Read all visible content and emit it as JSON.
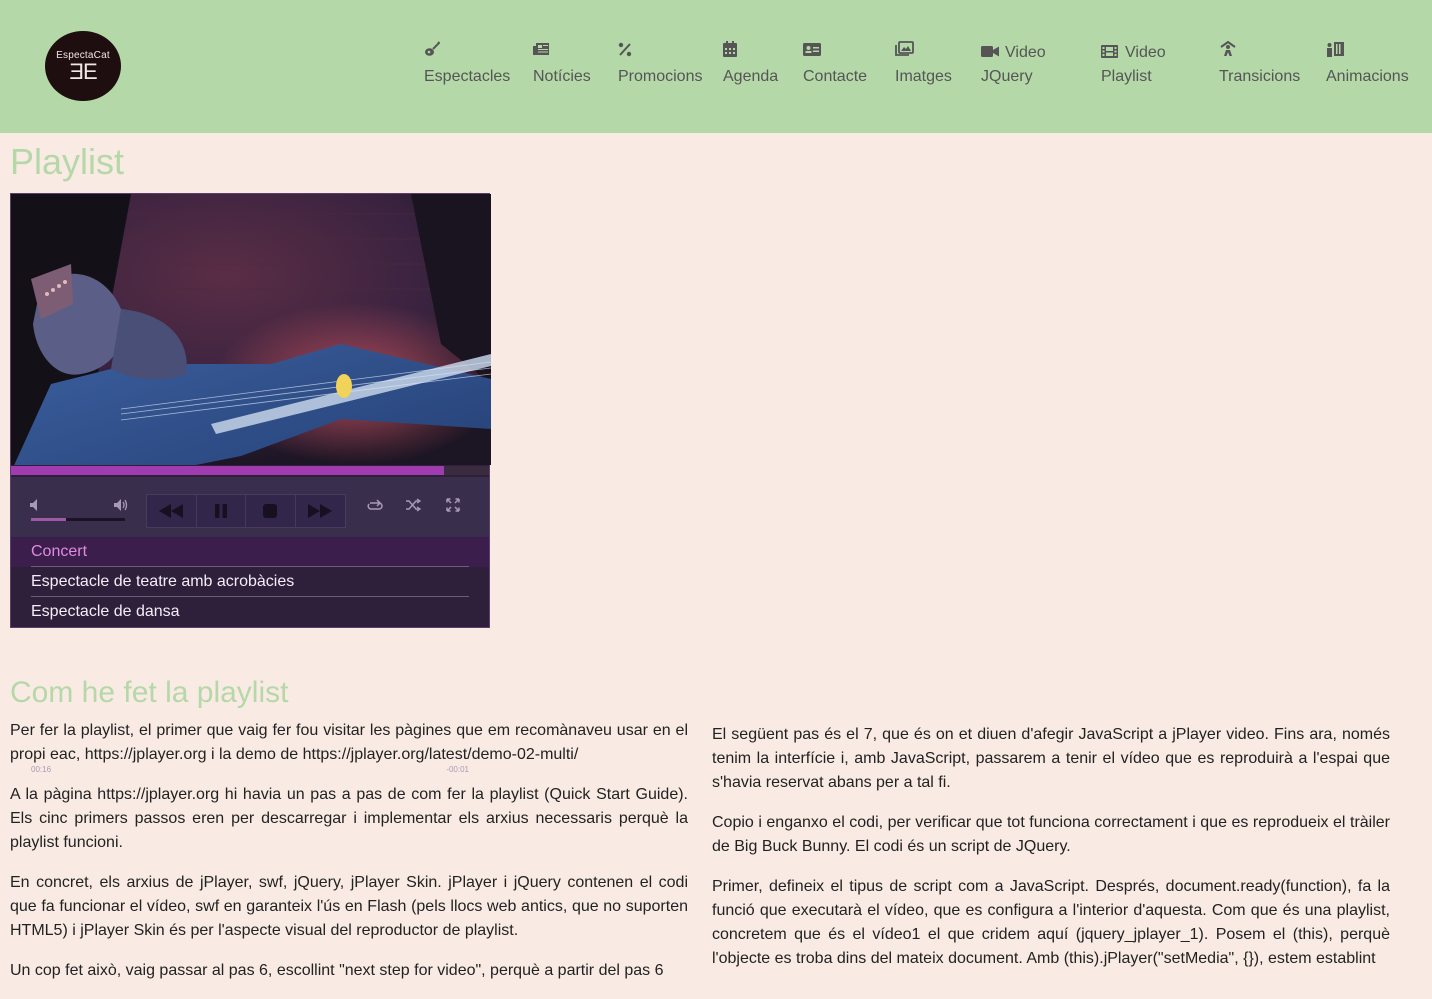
{
  "header": {
    "logo": {
      "line1": "EspectaCat",
      "line2": "ƎE"
    },
    "nav": [
      {
        "icon": "guitar-icon",
        "label": "Espectacles"
      },
      {
        "icon": "newspaper-icon",
        "label": "Notícies"
      },
      {
        "icon": "percent-icon",
        "label": "Promocions"
      },
      {
        "icon": "calendar-icon",
        "label": "Agenda"
      },
      {
        "icon": "address-card-icon",
        "label": "Contacte"
      },
      {
        "icon": "images-icon",
        "label": "Imatges"
      },
      {
        "icon": "video-camera-icon",
        "label": "Video\nJQuery"
      },
      {
        "icon": "film-icon",
        "label": "Video\nPlaylist"
      },
      {
        "icon": "person-rays-icon",
        "label": "Transicions"
      },
      {
        "icon": "person-book-icon",
        "label": "Animacions"
      }
    ]
  },
  "main": {
    "title": "Playlist",
    "player": {
      "current_time": "00:16",
      "remaining_time": "-00:01",
      "progress": 0.905,
      "volume": 0.37,
      "playlist": [
        {
          "label": "Concert",
          "current": true
        },
        {
          "label": "Espectacle de teatre amb acrobàcies",
          "current": false
        },
        {
          "label": "Espectacle de dansa",
          "current": false
        }
      ]
    },
    "section_title": "Com he fet la playlist",
    "left_paragraphs": [
      "Per fer la playlist, el primer que vaig fer fou visitar les pàgines que em recomànaveu usar en el propi eac, https://jplayer.org i la demo de https://jplayer.org/latest/demo-02-multi/",
      "A la pàgina https://jplayer.org hi havia un pas a pas de com fer la playlist (Quick Start Guide). Els cinc primers passos eren per descarregar i implementar els arxius necessaris perquè la playlist funcioni.",
      "En concret, els arxius de jPlayer, swf, jQuery, jPlayer Skin. jPlayer i jQuery contenen el codi que fa funcionar el vídeo, swf en garanteix l'ús en Flash (pels llocs web antics, que no suporten HTML5) i jPlayer Skin és per l'aspecte visual del reproductor de playlist.",
      "Un cop fet això, vaig passar al pas 6, escollint \"next step for video\", perquè a partir del pas 6"
    ],
    "right_paragraphs": [
      "El següent pas és el 7, que és on et diuen d'afegir JavaScript a jPlayer video. Fins ara, només tenim la interfície i, amb JavaScript, passarem a tenir el vídeo que es reproduirà a l'espai que s'havia reservat abans per a tal fi.",
      "Copio i enganxo el codi, per verificar que tot funciona correctament i que es reprodueix el tràiler de Big Buck Bunny. El codi és un script de JQuery.",
      "Primer, defineix el tipus de script com a JavaScript. Després, document.ready(function), fa la funció que executarà el vídeo, que es configura a l'interior d'aquesta. Com que és una playlist, concretem que és el vídeo1 el que cridem aquí (jquery_jplayer_1). Posem el (this), perquè l'objecte es troba dins del mateix document. Amb (this).jPlayer(\"setMedia\", {}), estem establint"
    ]
  }
}
